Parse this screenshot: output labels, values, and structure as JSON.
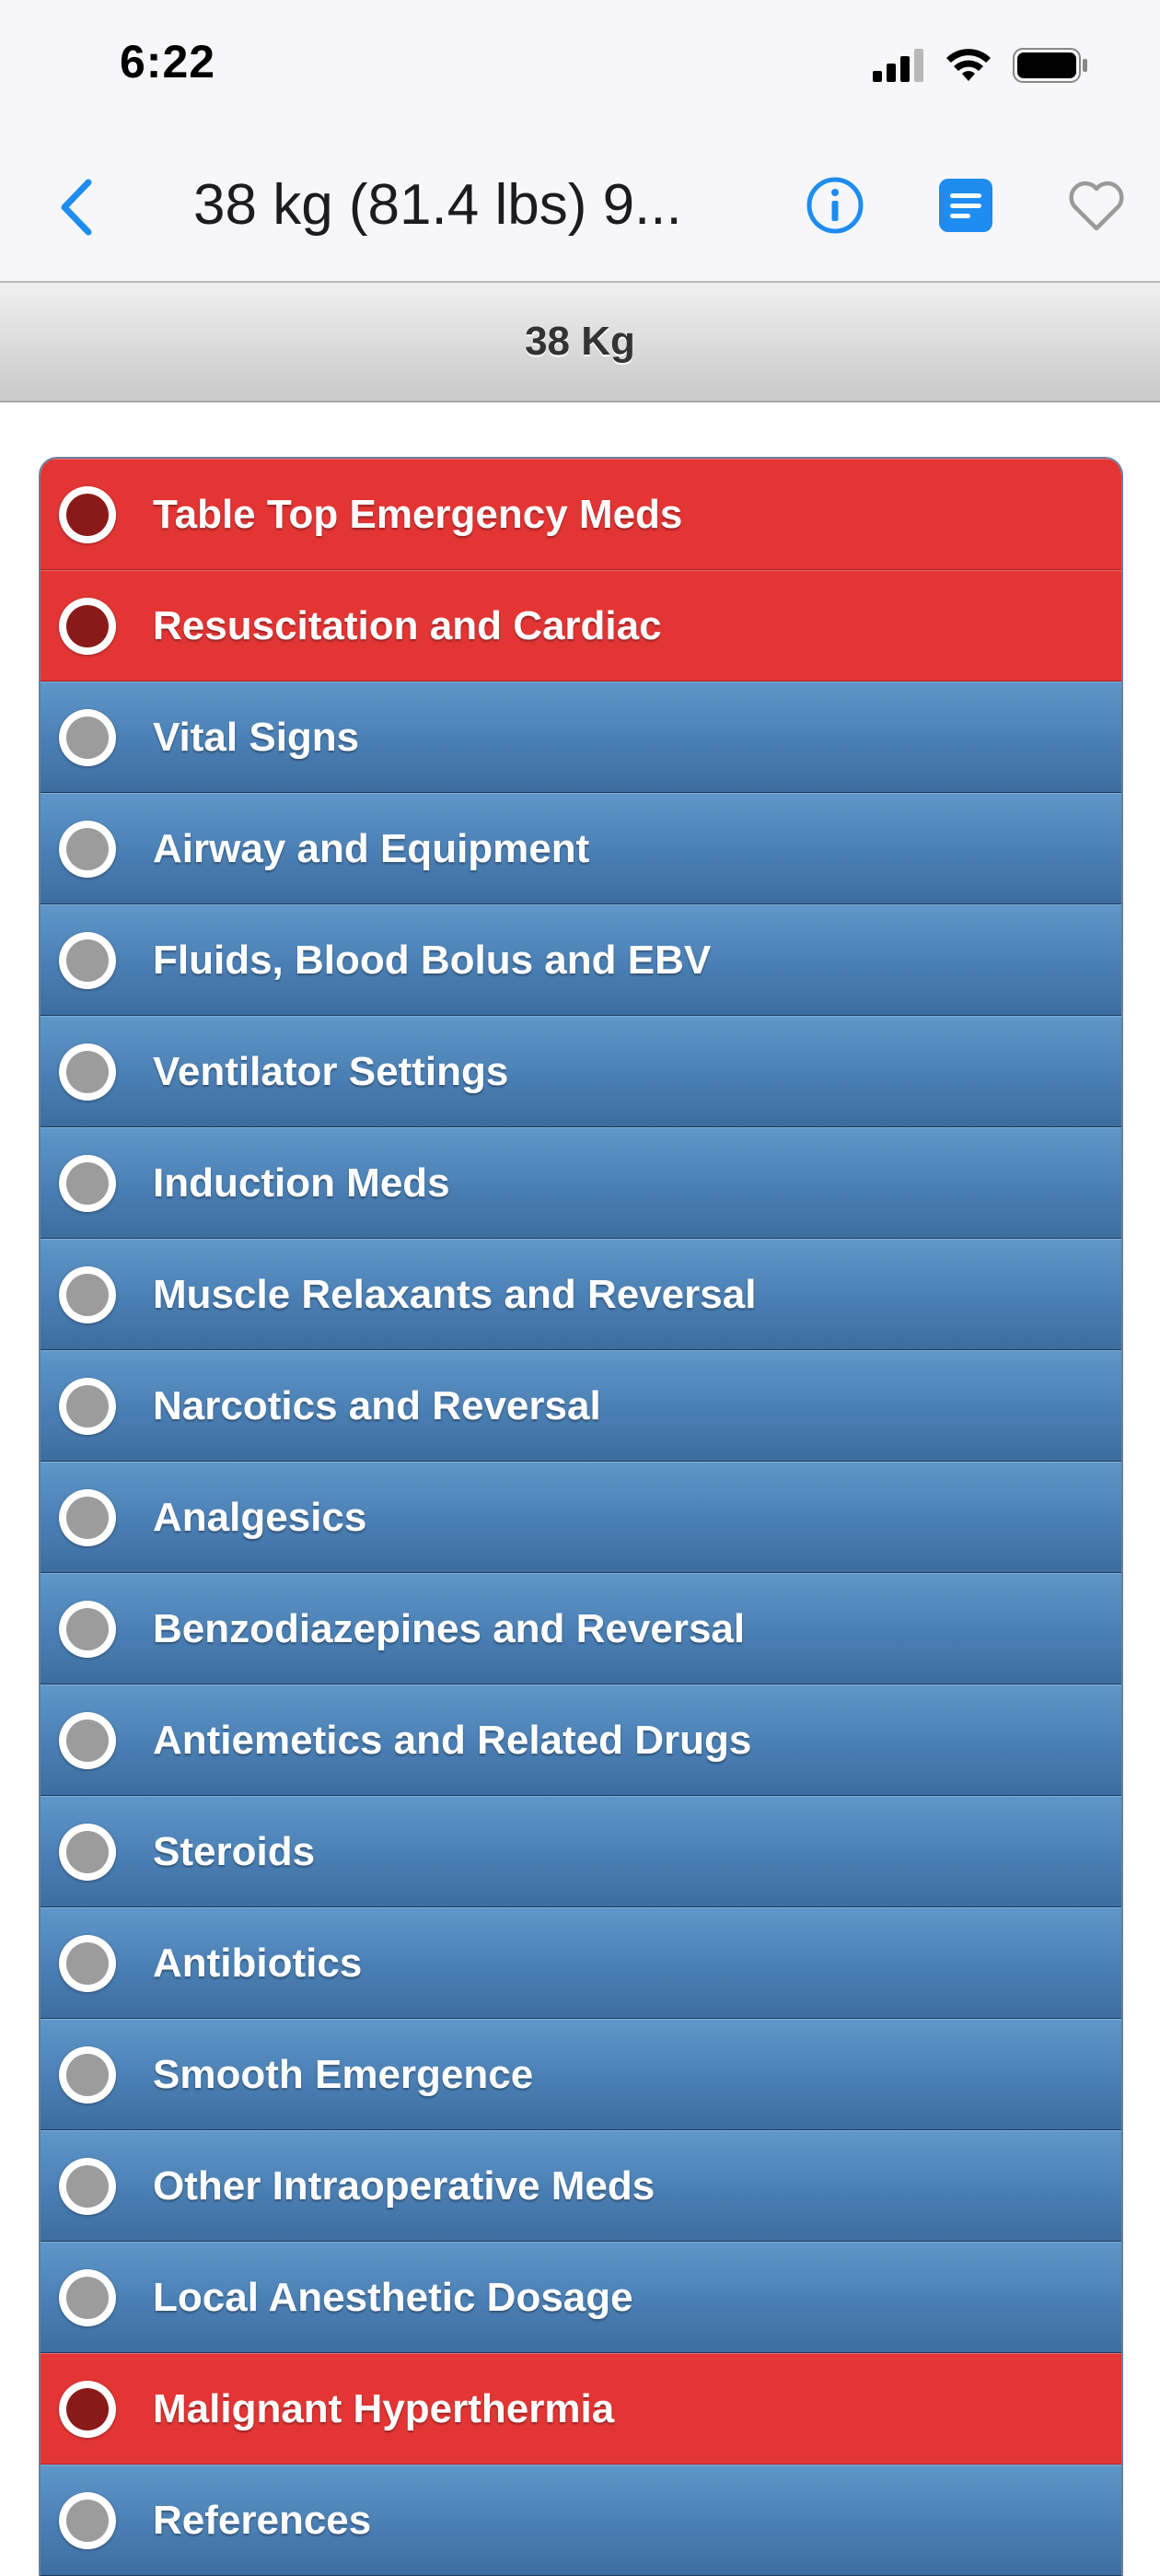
{
  "status_bar": {
    "time": "6:22"
  },
  "nav": {
    "title": "38 kg (81.4 lbs) 9...",
    "icons": {
      "back": "chevron-left-icon",
      "info": "info-icon",
      "notes": "notes-icon",
      "favorite": "heart-icon"
    },
    "accent_color": "#1e8cf0"
  },
  "header": {
    "weight_label": "38 Kg"
  },
  "colors": {
    "blue_item": "#4c81b6",
    "red_item": "#e43535"
  },
  "menu": {
    "items": [
      {
        "label": "Table Top Emergency Meds",
        "style": "red"
      },
      {
        "label": "Resuscitation and Cardiac",
        "style": "red"
      },
      {
        "label": "Vital Signs",
        "style": "blue"
      },
      {
        "label": "Airway and Equipment",
        "style": "blue"
      },
      {
        "label": "Fluids, Blood Bolus and EBV",
        "style": "blue"
      },
      {
        "label": "Ventilator Settings",
        "style": "blue"
      },
      {
        "label": "Induction Meds",
        "style": "blue"
      },
      {
        "label": "Muscle Relaxants and Reversal",
        "style": "blue"
      },
      {
        "label": "Narcotics and Reversal",
        "style": "blue"
      },
      {
        "label": "Analgesics",
        "style": "blue"
      },
      {
        "label": "Benzodiazepines and Reversal",
        "style": "blue"
      },
      {
        "label": "Antiemetics and Related Drugs",
        "style": "blue"
      },
      {
        "label": "Steroids",
        "style": "blue"
      },
      {
        "label": "Antibiotics",
        "style": "blue"
      },
      {
        "label": "Smooth Emergence",
        "style": "blue"
      },
      {
        "label": "Other Intraoperative Meds",
        "style": "blue"
      },
      {
        "label": "Local Anesthetic Dosage",
        "style": "blue"
      },
      {
        "label": "Malignant Hyperthermia",
        "style": "red"
      },
      {
        "label": "References",
        "style": "blue"
      }
    ]
  }
}
